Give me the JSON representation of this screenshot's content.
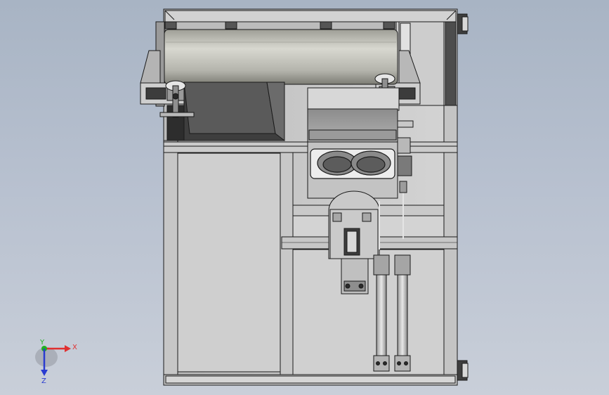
{
  "viewport": {
    "background_top": "#a8b4c4",
    "background_bottom": "#c9cfd9",
    "view_mode": "shaded-with-edges"
  },
  "model": {
    "description_colors": {
      "frame": "#c8c8c8",
      "edge": "#1a1a1a",
      "dark_panel": "#4a4a4a",
      "roller": "#b4b4ac"
    },
    "components": [
      "frame-outer",
      "roller-drum",
      "left-clamp-handle",
      "right-clamp-handle",
      "chute-dark",
      "cup-mold-block",
      "cup-cavities",
      "cross-beam",
      "linear-slide-carriage",
      "pneumatic-cylinder-left",
      "pneumatic-cylinder-right",
      "leveling-foot-top",
      "leveling-foot-bottom"
    ]
  },
  "triad": {
    "x_label": "X",
    "y_label": "Y",
    "z_label": "Z",
    "x_color": "#e03030",
    "y_color": "#20b020",
    "z_color": "#2a3cd0"
  }
}
